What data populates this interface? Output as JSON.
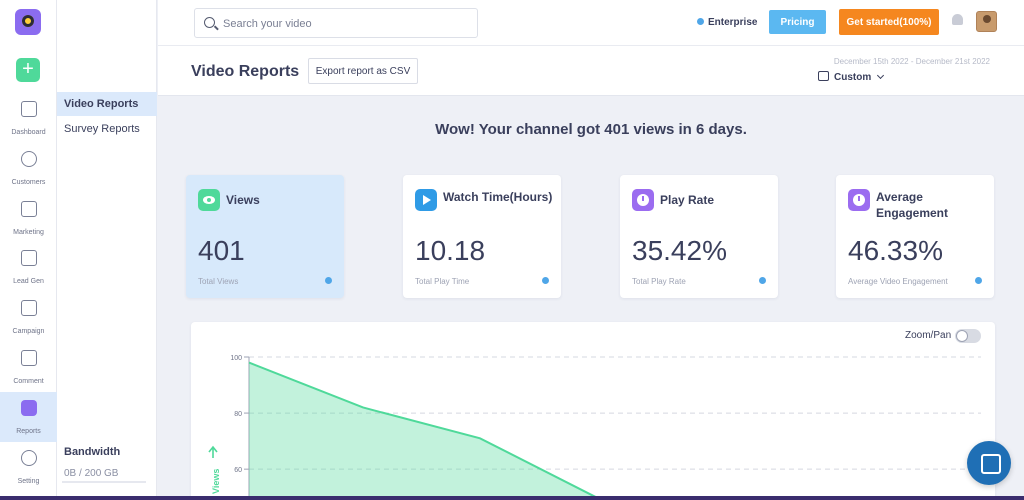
{
  "rail": {
    "items": [
      {
        "label": "Dashboard",
        "icon": "dashboard-icon"
      },
      {
        "label": "Customers",
        "icon": "user-icon"
      },
      {
        "label": "Marketing",
        "icon": "marketing-icon"
      },
      {
        "label": "Lead Gen",
        "icon": "lead-gen-icon"
      },
      {
        "label": "Campaign",
        "icon": "ad-icon"
      },
      {
        "label": "Comment",
        "icon": "comment-icon"
      },
      {
        "label": "Reports",
        "icon": "reports-icon"
      },
      {
        "label": "Setting",
        "icon": "gear-icon"
      }
    ],
    "active": "Reports"
  },
  "subnav": {
    "items": [
      "Video Reports",
      "Survey Reports"
    ],
    "bandwidth_title": "Bandwidth",
    "bandwidth_value": "0B / 200 GB"
  },
  "topbar": {
    "search_placeholder": "Search your video",
    "plan": "Enterprise",
    "pricing_label": "Pricing",
    "get_started_label": "Get started(100%)"
  },
  "header": {
    "title": "Video Reports",
    "export_label": "Export report as CSV",
    "date_range": "December 15th 2022 - December 21st 2022",
    "range_select": "Custom"
  },
  "headline": "Wow! Your channel got 401 views in 6 days.",
  "cards": [
    {
      "title": "Views",
      "value": "401",
      "subtitle": "Total Views",
      "icon_color": "#4fd99a"
    },
    {
      "title": "Watch Time(Hours)",
      "value": "10.18",
      "subtitle": "Total Play Time",
      "icon_color": "#2f9be6"
    },
    {
      "title": "Play Rate",
      "value": "35.42%",
      "subtitle": "Total Play Rate",
      "icon_color": "#9b6cf0"
    },
    {
      "title": "Average Engagement",
      "value": "46.33%",
      "subtitle": "Average Video Engagement",
      "icon_color": "#9b6cf0"
    }
  ],
  "chart": {
    "zoom_label": "Zoom/Pan",
    "zoom_enabled": false
  },
  "chart_data": {
    "type": "area",
    "ylabel": "Views",
    "yticks": [
      "100",
      "80",
      "60"
    ],
    "ylim_visible": [
      50,
      100
    ],
    "x_index": [
      0,
      1,
      2,
      3
    ],
    "values": [
      98,
      82,
      71,
      50
    ],
    "color": "#4fd99a"
  }
}
